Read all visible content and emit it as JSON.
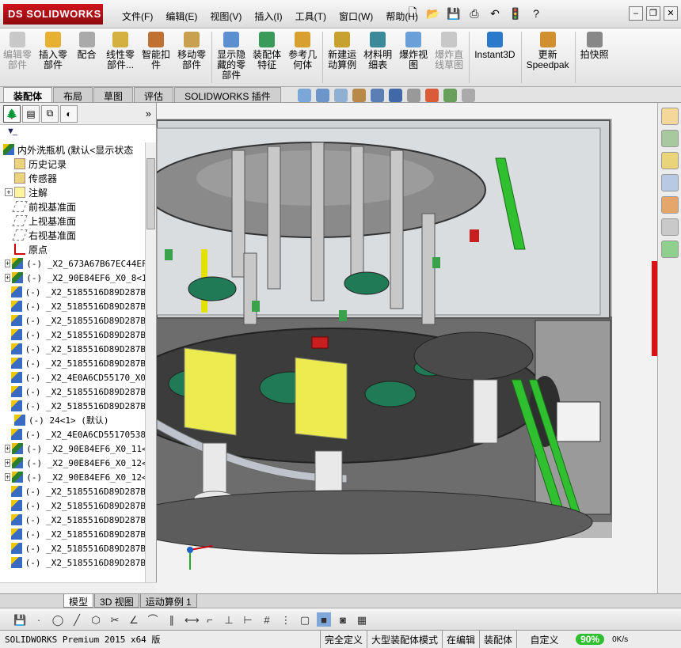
{
  "app": {
    "brand": "SOLIDWORKS",
    "brand_prefix": "DS"
  },
  "menu": [
    "文件(F)",
    "编辑(E)",
    "视图(V)",
    "插入(I)",
    "工具(T)",
    "窗口(W)",
    "帮助(H)"
  ],
  "ribbon": [
    {
      "label": "编辑零\n部件",
      "icon": "edit-component-icon",
      "disabled": true
    },
    {
      "label": "插入零\n部件",
      "icon": "insert-components-icon",
      "disabled": false
    },
    {
      "label": "配合",
      "icon": "mate-icon",
      "disabled": false
    },
    {
      "label": "线性零\n部件...",
      "icon": "linear-pattern-icon",
      "disabled": false
    },
    {
      "label": "智能扣\n件",
      "icon": "smart-fasteners-icon",
      "disabled": false
    },
    {
      "label": "移动零\n部件",
      "icon": "move-component-icon",
      "disabled": false
    },
    {
      "label": "显示隐\n藏的零\n部件",
      "icon": "show-hidden-icon",
      "disabled": false
    },
    {
      "label": "装配体\n特征",
      "icon": "assembly-features-icon",
      "disabled": false
    },
    {
      "label": "参考几\n何体",
      "icon": "reference-geometry-icon",
      "disabled": false
    },
    {
      "label": "新建运\n动算例",
      "icon": "motion-study-icon",
      "disabled": false
    },
    {
      "label": "材料明\n细表",
      "icon": "bom-icon",
      "disabled": false
    },
    {
      "label": "爆炸视\n图",
      "icon": "exploded-view-icon",
      "disabled": false
    },
    {
      "label": "爆炸直\n线草图",
      "icon": "explode-line-icon",
      "disabled": true
    },
    {
      "label": "Instant3D",
      "icon": "instant3d-icon",
      "disabled": false
    },
    {
      "label": "更新\nSpeedpak",
      "icon": "speedpak-icon",
      "disabled": false
    },
    {
      "label": "拍快照",
      "icon": "snapshot-icon",
      "disabled": false
    }
  ],
  "command_tabs": [
    "装配体",
    "布局",
    "草图",
    "评估",
    "SOLIDWORKS 插件"
  ],
  "tree": {
    "root": "内外洗瓶机  (默认<显示状态",
    "items": [
      {
        "label": "历史记录",
        "type": "folder",
        "expandable": false
      },
      {
        "label": "传感器",
        "type": "folder",
        "expandable": false
      },
      {
        "label": "注解",
        "type": "ann",
        "expandable": true
      },
      {
        "label": "前视基准面",
        "type": "plane",
        "expandable": false
      },
      {
        "label": "上视基准面",
        "type": "plane",
        "expandable": false
      },
      {
        "label": "右视基准面",
        "type": "plane",
        "expandable": false
      },
      {
        "label": "原点",
        "type": "origin",
        "expandable": false
      },
      {
        "label": "(-) _X2_673A67B67EC44EF",
        "type": "asm",
        "expandable": true
      },
      {
        "label": "(-) _X2_90E84EF6_X0_8<1",
        "type": "asm",
        "expandable": true
      },
      {
        "label": "(-) _X2_5185516D89D287B",
        "type": "part",
        "expandable": false
      },
      {
        "label": "(-) _X2_5185516D89D287B",
        "type": "part",
        "expandable": false
      },
      {
        "label": "(-) _X2_5185516D89D287B",
        "type": "part",
        "expandable": false
      },
      {
        "label": "(-) _X2_5185516D89D287B",
        "type": "part",
        "expandable": false
      },
      {
        "label": "(-) _X2_5185516D89D287B",
        "type": "part",
        "expandable": false
      },
      {
        "label": "(-) _X2_5185516D89D287B",
        "type": "part",
        "expandable": false
      },
      {
        "label": "(-) _X2_4E0A6CD55170_X0",
        "type": "part",
        "expandable": false
      },
      {
        "label": "(-) _X2_5185516D89D287B",
        "type": "part",
        "expandable": false
      },
      {
        "label": "(-) _X2_5185516D89D287B",
        "type": "part",
        "expandable": false
      },
      {
        "label": "(-) 24<1> (默认)",
        "type": "part",
        "expandable": false
      },
      {
        "label": "(-) _X2_4E0A6CD55170538",
        "type": "part",
        "expandable": false
      },
      {
        "label": "(-) _X2_90E84EF6_X0_11<",
        "type": "asm",
        "expandable": true
      },
      {
        "label": "(-) _X2_90E84EF6_X0_12<",
        "type": "asm",
        "expandable": true
      },
      {
        "label": "(-) _X2_90E84EF6_X0_12<",
        "type": "asm",
        "expandable": true
      },
      {
        "label": "(-) _X2_5185516D89D287B",
        "type": "part",
        "expandable": false
      },
      {
        "label": "(-) _X2_5185516D89D287B",
        "type": "part",
        "expandable": false
      },
      {
        "label": "(-) _X2_5185516D89D287B",
        "type": "part",
        "expandable": false
      },
      {
        "label": "(-) _X2_5185516D89D287B",
        "type": "part",
        "expandable": false
      },
      {
        "label": "(-) _X2_5185516D89D287B",
        "type": "part",
        "expandable": false
      },
      {
        "label": "(-) _X2_5185516D89D287B",
        "type": "part",
        "expandable": false
      }
    ]
  },
  "bottom_tabs": [
    "模型",
    "3D 视图",
    "运动算例 1"
  ],
  "status": {
    "product": "SOLIDWORKS Premium 2015 x64 版",
    "definition": "完全定义",
    "mode": "大型装配体模式",
    "editing": "在编辑",
    "doc": "装配体",
    "units": "自定义",
    "progress": "90%",
    "net": "0K/s"
  },
  "colors": {
    "brand_red": "#c8101a",
    "accent_green": "#2fbf2f",
    "accent_yellow": "#e6e000"
  }
}
